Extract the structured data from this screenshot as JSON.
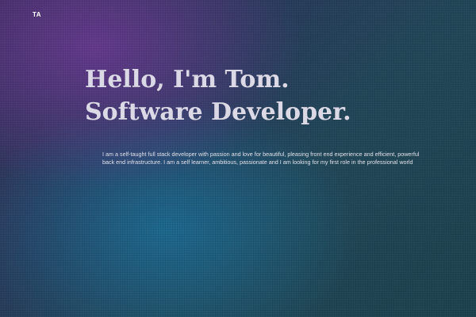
{
  "logo": {
    "text": "TA"
  },
  "hero": {
    "line1": "Hello, I'm Tom.",
    "line2": "Software Developer."
  },
  "bio": {
    "text": "I am a self-taught full stack developer with passion and love for beautiful, pleasing front end experience and efficient, powerful back end infrastructure. I am a self learner, ambitious, passionate and I am looking for my first role in the professional world"
  },
  "colors": {
    "background_top_left": "#3b2f5e",
    "background_bottom": "#1f4550",
    "heading_text": "#dcd9e6",
    "body_text": "#e1e1ea"
  }
}
